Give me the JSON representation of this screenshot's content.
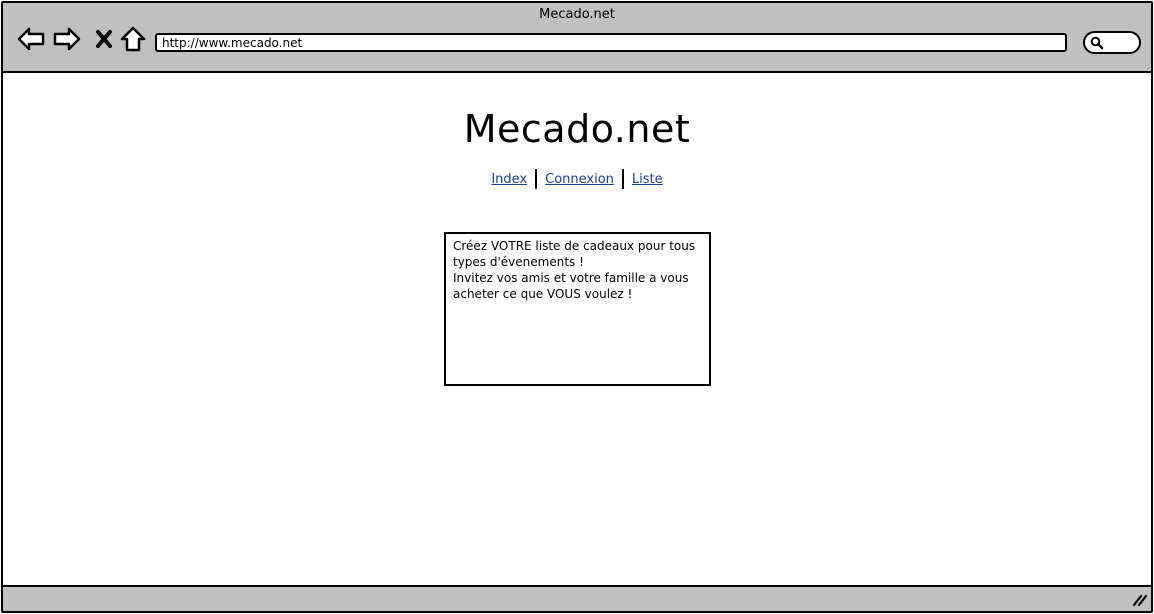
{
  "window": {
    "title": "Mecado.net"
  },
  "toolbar": {
    "back_icon": "back-arrow-icon",
    "forward_icon": "forward-arrow-icon",
    "stop_icon": "close-icon",
    "home_icon": "home-icon",
    "search_icon": "search-icon"
  },
  "address": {
    "url": "http://www.mecado.net"
  },
  "site": {
    "title": "Mecado.net",
    "nav": [
      {
        "label": "Index"
      },
      {
        "label": "Connexion"
      },
      {
        "label": "Liste"
      }
    ]
  },
  "intro": {
    "line1": "Créez VOTRE liste de cadeaux pour tous types d'évenements !",
    "line2": "Invitez vos amis et votre famille a vous acheter ce que VOUS voulez !"
  },
  "colors": {
    "chrome": "#c0c0c0",
    "link": "#1a3f8f",
    "border": "#000000"
  }
}
